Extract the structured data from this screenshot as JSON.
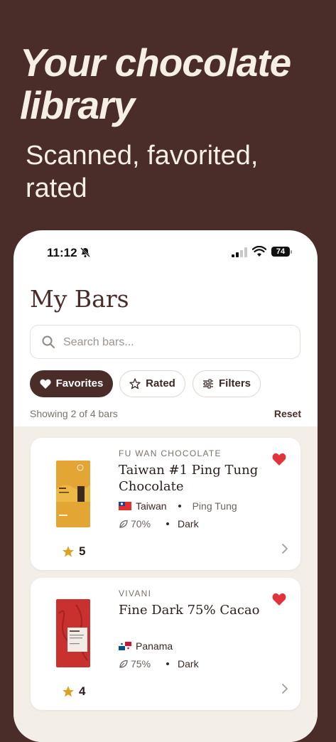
{
  "hero": {
    "title": "Your chocolate library",
    "subtitle": "Scanned, favorited, rated"
  },
  "status_bar": {
    "time": "11:12",
    "battery": "74"
  },
  "page": {
    "title": "My Bars"
  },
  "search": {
    "placeholder": "Search bars..."
  },
  "filters": {
    "favorites": "Favorites",
    "rated": "Rated",
    "filters": "Filters"
  },
  "summary": {
    "showing": "Showing 2 of 4 bars",
    "reset": "Reset"
  },
  "bars": [
    {
      "maker": "FU WAN CHOCOLATE",
      "name": "Taiwan #1 Ping Tung Chocolate",
      "country": "Taiwan",
      "region": "Ping Tung",
      "cacao": "70%",
      "type": "Dark",
      "rating": "5",
      "favorite": true,
      "wrapper_color": "#e3a533",
      "flag": "taiwan-flag"
    },
    {
      "maker": "VIVANI",
      "name": "Fine Dark 75% Cacao",
      "country": "Panama",
      "region": "",
      "cacao": "75%",
      "type": "Dark",
      "rating": "4",
      "favorite": true,
      "wrapper_color": "#c8312e",
      "flag": "panama-flag"
    }
  ],
  "colors": {
    "brand_brown": "#4a2c29",
    "cream": "#f6efe6",
    "heart_red": "#e0333c",
    "star_gold": "#d9a323"
  }
}
